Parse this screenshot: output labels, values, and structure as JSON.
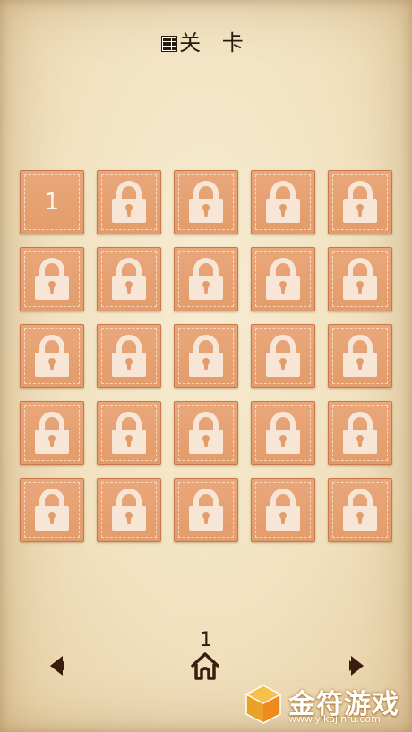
{
  "header": {
    "title": "关 卡",
    "icon": "level-grid-icon"
  },
  "levels": [
    {
      "label": "1",
      "locked": false
    },
    {
      "label": "",
      "locked": true
    },
    {
      "label": "",
      "locked": true
    },
    {
      "label": "",
      "locked": true
    },
    {
      "label": "",
      "locked": true
    },
    {
      "label": "",
      "locked": true
    },
    {
      "label": "",
      "locked": true
    },
    {
      "label": "",
      "locked": true
    },
    {
      "label": "",
      "locked": true
    },
    {
      "label": "",
      "locked": true
    },
    {
      "label": "",
      "locked": true
    },
    {
      "label": "",
      "locked": true
    },
    {
      "label": "",
      "locked": true
    },
    {
      "label": "",
      "locked": true
    },
    {
      "label": "",
      "locked": true
    },
    {
      "label": "",
      "locked": true
    },
    {
      "label": "",
      "locked": true
    },
    {
      "label": "",
      "locked": true
    },
    {
      "label": "",
      "locked": true
    },
    {
      "label": "",
      "locked": true
    },
    {
      "label": "",
      "locked": true
    },
    {
      "label": "",
      "locked": true
    },
    {
      "label": "",
      "locked": true
    },
    {
      "label": "",
      "locked": true
    },
    {
      "label": "",
      "locked": true
    }
  ],
  "footer": {
    "page_number": "1",
    "prev_icon": "arrow-left-icon",
    "home_icon": "home-icon",
    "next_icon": "arrow-right-icon"
  },
  "watermark": {
    "text": "金符游戏",
    "url": "www.yikajinfu.com"
  },
  "colors": {
    "tile": "#e39c6b",
    "tile_border": "#c8784a",
    "lock": "#f7e6d6",
    "text": "#2a1a0e"
  }
}
